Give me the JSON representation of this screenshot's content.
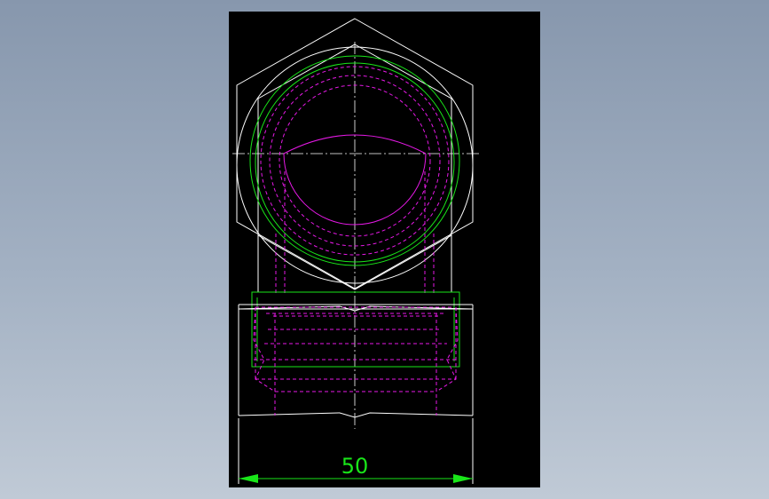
{
  "colors": {
    "background": "#000000",
    "outline": "#ffffff",
    "dimension": "#19e619",
    "hidden": "#e619e6"
  },
  "drawing": {
    "dimension_value": "50"
  }
}
